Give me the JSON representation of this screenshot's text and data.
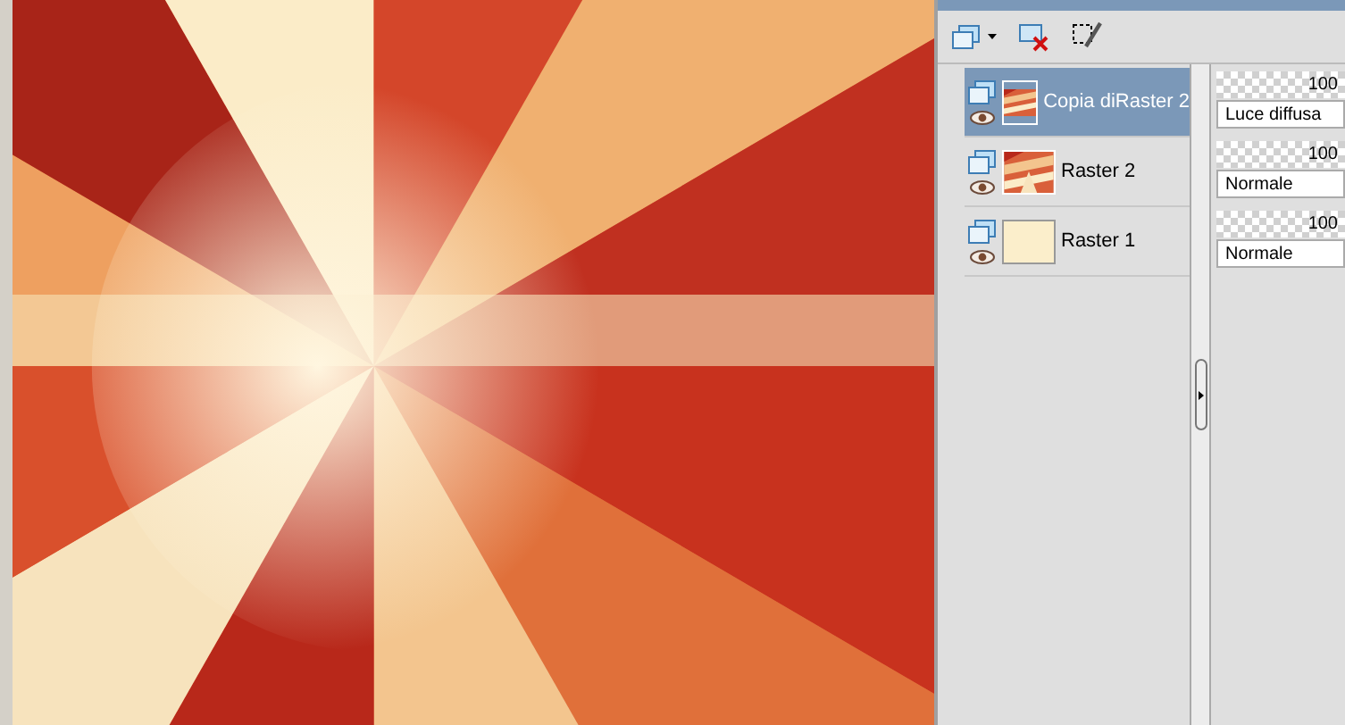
{
  "layers": [
    {
      "name": "Copia diRaster 2",
      "selected": true,
      "kind": "streaks",
      "opacity": "100",
      "level": 1,
      "blend": "Luce diffusa"
    },
    {
      "name": "Raster 2",
      "selected": false,
      "kind": "burst",
      "opacity": "100",
      "level": 1,
      "blend": "Normale"
    },
    {
      "name": "Raster 1",
      "selected": false,
      "kind": "plain",
      "opacity": "100",
      "level": 1,
      "blend": "Normale"
    }
  ]
}
